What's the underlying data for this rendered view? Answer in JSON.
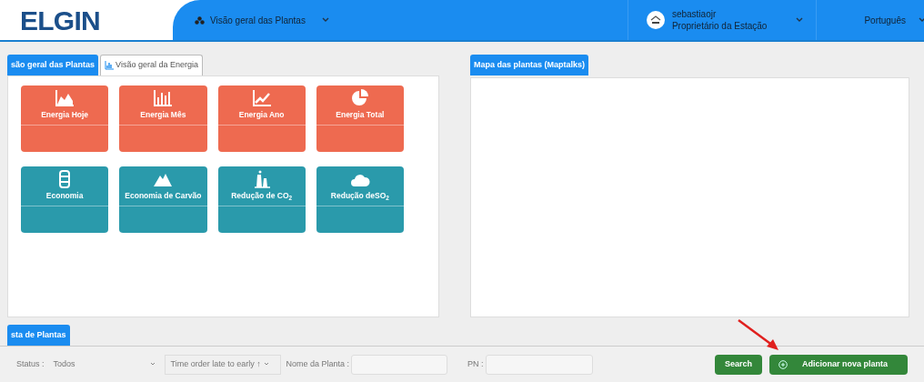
{
  "header": {
    "logo": "ELGIN",
    "nav": {
      "label": "Visão geral das Plantas"
    },
    "user": {
      "name": "sebastiaojr",
      "role": "Proprietário da Estação"
    },
    "language": "Português"
  },
  "left_panel": {
    "tabs": [
      {
        "label": "são geral das Plantas",
        "selected": true
      },
      {
        "label": "Visão geral da Energia",
        "selected": false
      }
    ],
    "tiles": [
      {
        "label": "Energia Hoje",
        "kind": "area",
        "color": "#ee6a50"
      },
      {
        "label": "Energia Mês",
        "kind": "bars",
        "color": "#ee6a50"
      },
      {
        "label": "Energia Ano",
        "kind": "line",
        "color": "#ee6a50"
      },
      {
        "label": "Energia Total",
        "kind": "pie",
        "color": "#ee6a50"
      },
      {
        "label": "Economia",
        "kind": "database",
        "color": "#2a9aab"
      },
      {
        "label": "Economia de Carvão",
        "kind": "mountain",
        "color": "#2a9aab"
      },
      {
        "label": "Redução de CO$_{2}$",
        "kind": "factory",
        "color": "#2a9aab"
      },
      {
        "label": "Redução deSO$_{2}$",
        "kind": "cloud",
        "color": "#2a9aab"
      }
    ]
  },
  "right_panel": {
    "tab": {
      "label": "Mapa das plantas (Maptalks)",
      "selected": true
    }
  },
  "plant_list": {
    "tab": {
      "label": "sta de Plantas",
      "selected": true
    },
    "filters": {
      "status_label": "Status :",
      "status_value": "Todos",
      "order_value": "Time order late to early ↑",
      "name_label": "Nome da Planta :",
      "pn_label": "PN :"
    },
    "buttons": [
      {
        "label": "Search",
        "kind": "plain"
      },
      {
        "label": "Adicionar nova planta",
        "kind": "add"
      }
    ]
  }
}
